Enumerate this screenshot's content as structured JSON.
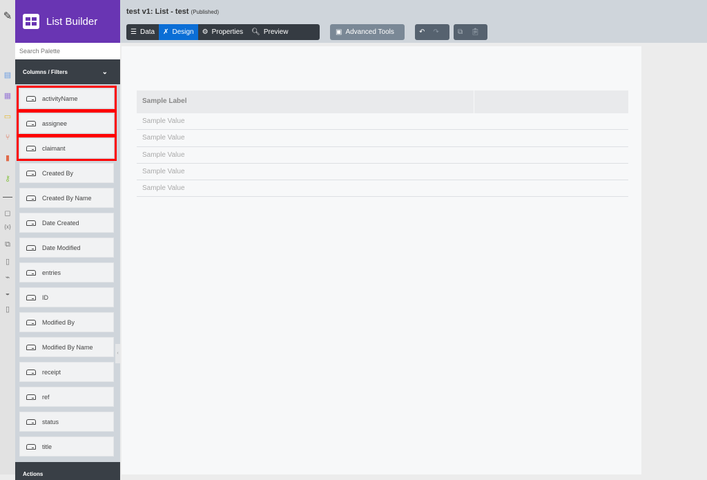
{
  "app": {
    "title": "List Builder"
  },
  "header": {
    "title": "test v1: List - test",
    "status": "(Published)"
  },
  "toolbar": {
    "data": "Data",
    "design": "Design",
    "properties": "Properties",
    "preview": "Preview",
    "advanced": "Advanced Tools"
  },
  "palette": {
    "search_placeholder": "Search Palette",
    "section": "Columns / Filters",
    "actions": "Actions",
    "items": [
      "activityName",
      "assignee",
      "claimant",
      "Created By",
      "Created By Name",
      "Date Created",
      "Date Modified",
      "entries",
      "ID",
      "Modified By",
      "Modified By Name",
      "receipt",
      "ref",
      "status",
      "title"
    ],
    "highlighted": [
      "activityName",
      "assignee",
      "claimant"
    ]
  },
  "table": {
    "header": "Sample Label",
    "rows": [
      "Sample Value",
      "Sample Value",
      "Sample Value",
      "Sample Value",
      "Sample Value"
    ]
  },
  "colors": {
    "brand": "#6935b3",
    "active": "#0b6ed6",
    "highlight": "#ff0000"
  }
}
